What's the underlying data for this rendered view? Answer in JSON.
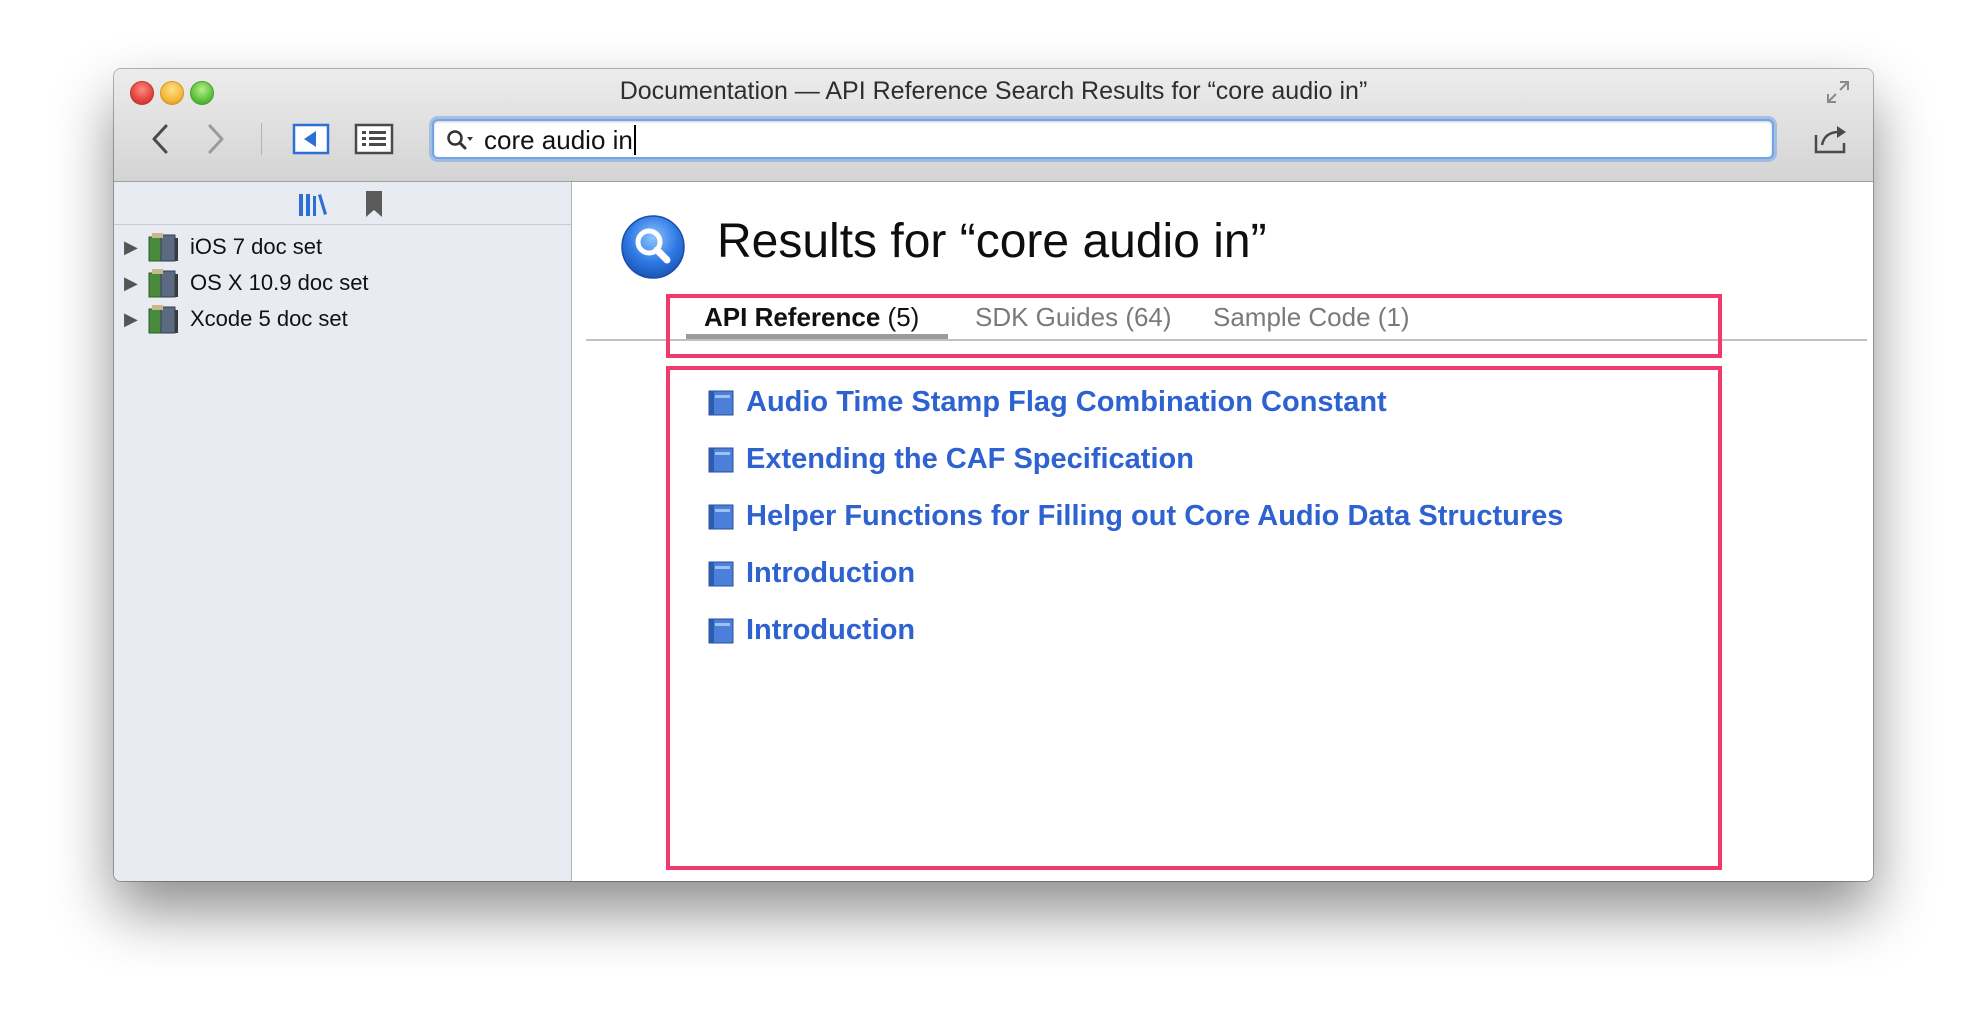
{
  "window": {
    "title": "Documentation — API Reference Search Results for “core audio in”"
  },
  "toolbar": {
    "back_icon": "chevron-left-icon",
    "forward_icon": "chevron-right-icon",
    "sidebar_toggle_icon": "sidebar-toggle-icon",
    "toc_icon": "list-icon",
    "share_icon": "share-icon"
  },
  "search": {
    "value": "core audio in",
    "icon": "search-icon"
  },
  "sidebar": {
    "tabs": [
      {
        "icon": "library-icon"
      },
      {
        "icon": "bookmark-icon"
      }
    ],
    "items": [
      {
        "label": "iOS 7 doc set"
      },
      {
        "label": "OS X 10.9 doc set"
      },
      {
        "label": "Xcode 5 doc set"
      }
    ]
  },
  "content": {
    "title": "Results for “core audio in”",
    "tabs": [
      {
        "name": "API Reference",
        "count": "(5)",
        "active": true
      },
      {
        "name": "SDK Guides",
        "count": "(64)",
        "active": false
      },
      {
        "name": "Sample Code",
        "count": "(1)",
        "active": false
      }
    ],
    "results": [
      {
        "label": "Audio Time Stamp Flag Combination Constant"
      },
      {
        "label": "Extending the CAF Specification"
      },
      {
        "label": "Helper Functions for Filling out Core Audio Data Structures"
      },
      {
        "label": "Introduction"
      },
      {
        "label": "Introduction"
      }
    ]
  },
  "colors": {
    "link": "#2d62d0",
    "highlight": "#f1396d",
    "sidebar_bg": "#e8ecf2"
  }
}
